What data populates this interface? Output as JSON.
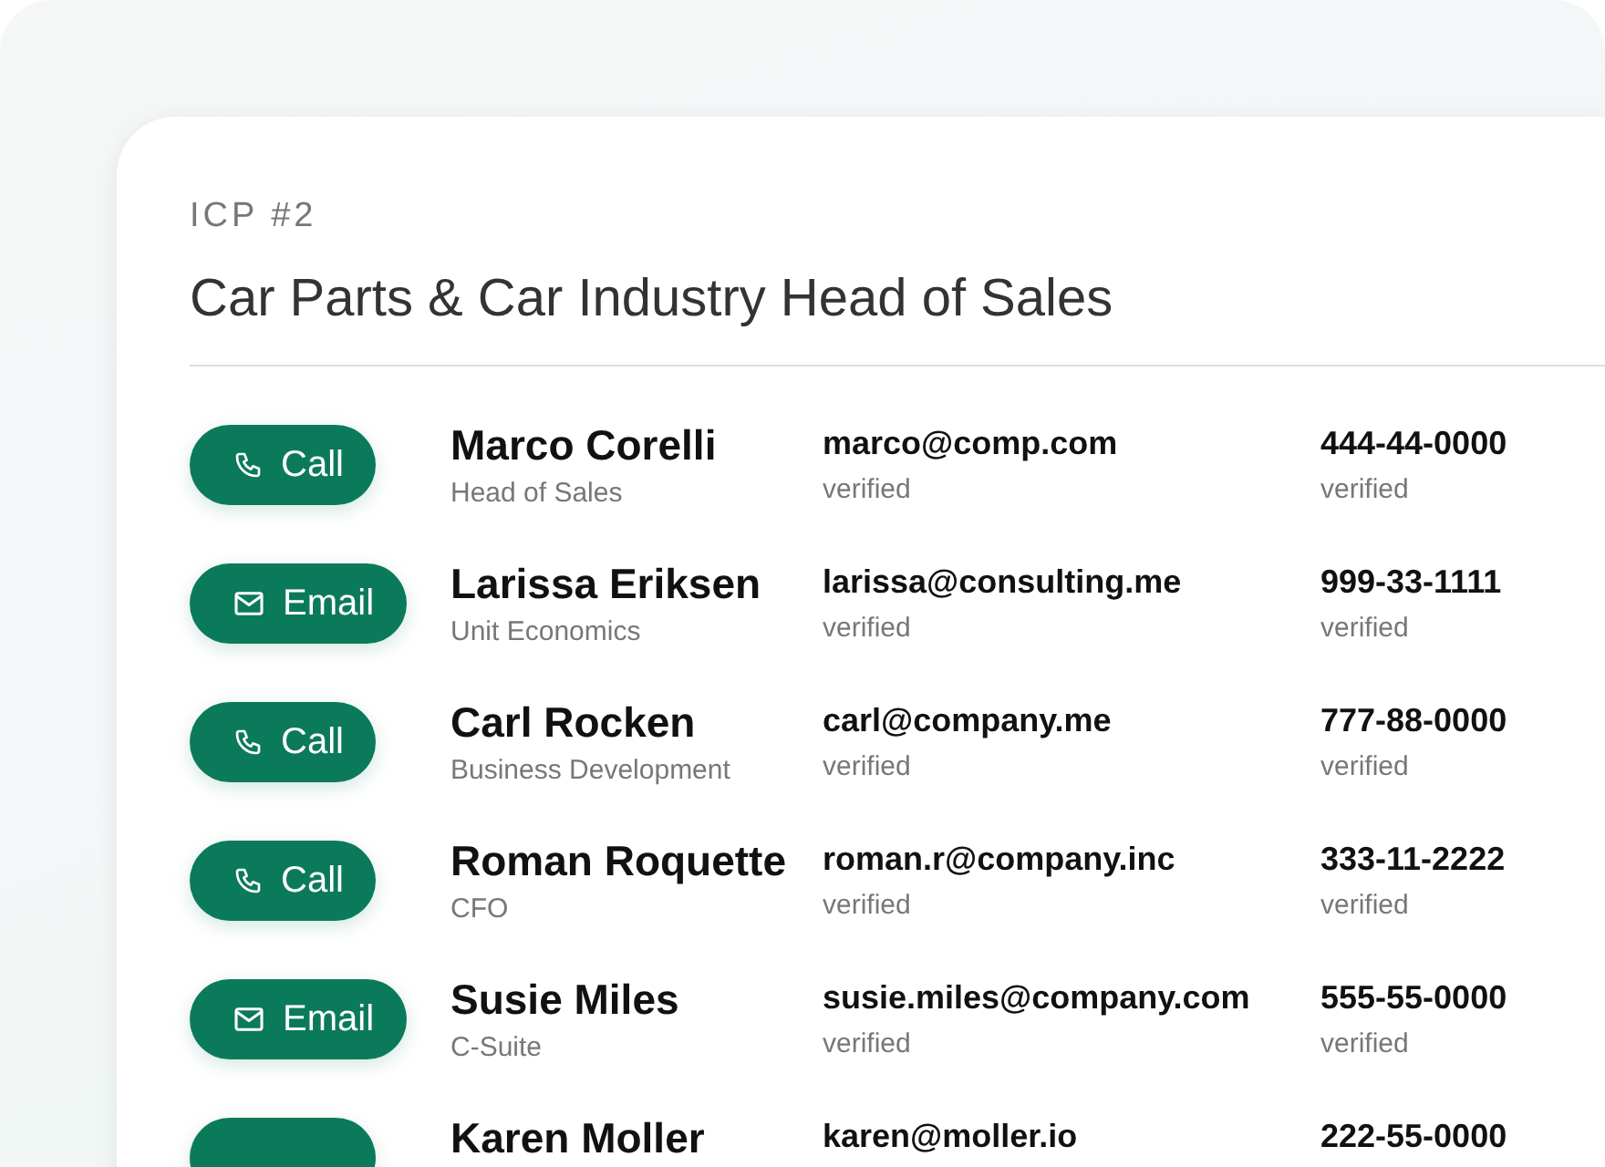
{
  "card": {
    "eyebrow": "ICP #2",
    "title": "Car Parts & Car Industry Head of Sales"
  },
  "contacts": [
    {
      "kind": "call",
      "action": "Call",
      "name": "Marco Corelli",
      "role": "Head of Sales",
      "email": "marco@comp.com",
      "email_status": "verified",
      "phone": "444-44-0000",
      "phone_status": "verified"
    },
    {
      "kind": "email",
      "action": "Email",
      "name": "Larissa Eriksen",
      "role": "Unit Economics",
      "email": "larissa@consulting.me",
      "email_status": "verified",
      "phone": "999-33-1111",
      "phone_status": "verified"
    },
    {
      "kind": "call",
      "action": "Call",
      "name": "Carl Rocken",
      "role": "Business Development",
      "email": "carl@company.me",
      "email_status": "verified",
      "phone": "777-88-0000",
      "phone_status": "verified"
    },
    {
      "kind": "call",
      "action": "Call",
      "name": "Roman Roquette",
      "role": "CFO",
      "email": "roman.r@company.inc",
      "email_status": "verified",
      "phone": "333-11-2222",
      "phone_status": "verified"
    },
    {
      "kind": "email",
      "action": "Email",
      "name": "Susie Miles",
      "role": "C-Suite",
      "email": "susie.miles@company.com",
      "email_status": "verified",
      "phone": "555-55-0000",
      "phone_status": "verified"
    },
    {
      "kind": "partial",
      "name": "Karen Moller",
      "email": "karen@moller.io",
      "phone": "222-55-0000"
    }
  ]
}
